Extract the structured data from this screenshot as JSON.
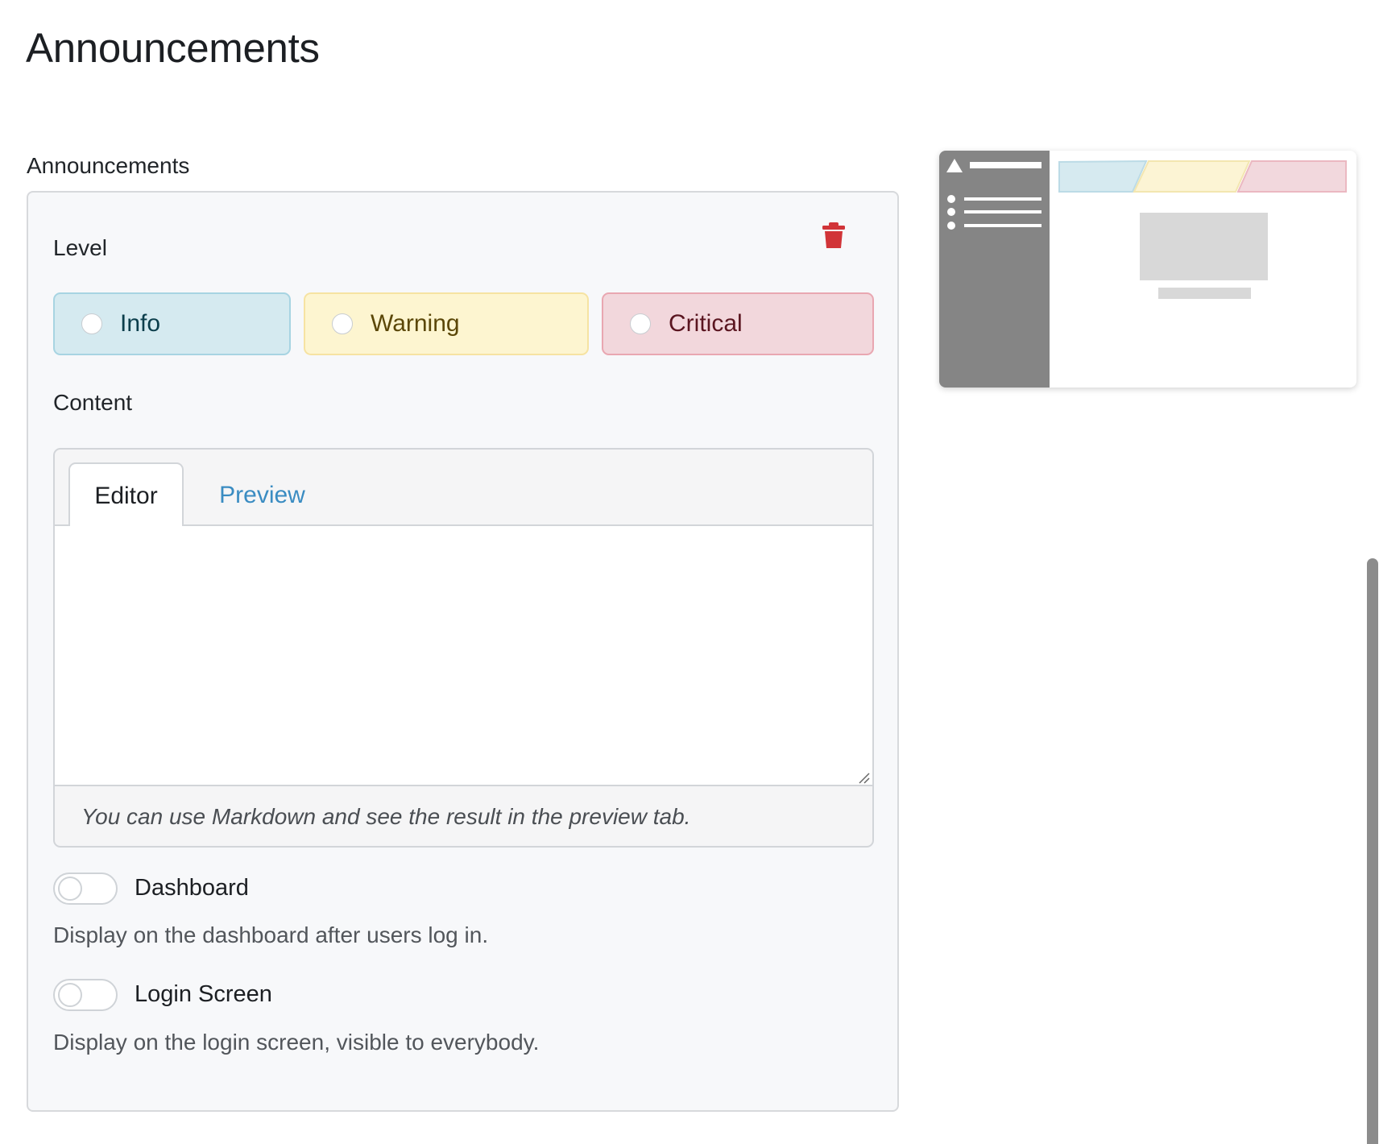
{
  "page": {
    "title": "Announcements"
  },
  "section": {
    "label": "Announcements"
  },
  "announcement": {
    "level_label": "Level",
    "levels": [
      {
        "label": "Info",
        "selected": false,
        "bg": "#d5eaf0",
        "border": "#a7d4e2"
      },
      {
        "label": "Warning",
        "selected": false,
        "bg": "#fdf5d0",
        "border": "#f6e3a2"
      },
      {
        "label": "Critical",
        "selected": false,
        "bg": "#f2d7dc",
        "border": "#e9a7b1"
      }
    ],
    "content_label": "Content",
    "tabs": [
      {
        "label": "Editor",
        "active": true
      },
      {
        "label": "Preview",
        "active": false
      }
    ],
    "editor_value": "",
    "editor_hint": "You can use Markdown and see the result in the preview tab.",
    "toggles": [
      {
        "label": "Dashboard",
        "enabled": false,
        "help": "Display on the dashboard after users log in."
      },
      {
        "label": "Login Screen",
        "enabled": false,
        "help": "Display on the login screen, visible to everybody."
      }
    ],
    "delete_icon": "trash-icon",
    "delete_color": "#d13438"
  },
  "colors": {
    "link_blue": "#3a8cc2",
    "card_background": "#f7f8fa"
  }
}
